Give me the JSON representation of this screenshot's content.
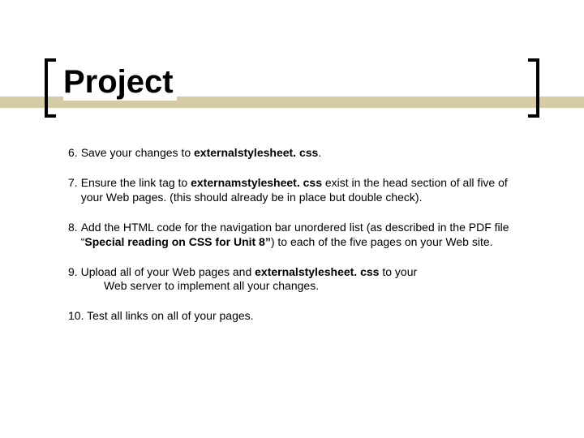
{
  "title": "Project",
  "items": {
    "i6": {
      "num": "6.",
      "t1": "Save your changes to ",
      "b1": "externalstylesheet. css",
      "t2": "."
    },
    "i7": {
      "num": "7.",
      "t1": "Ensure the link tag to ",
      "b1": "externamstylesheet. css",
      "t2": " exist in the head section of all five of your Web pages. (this should already be in place but double check)."
    },
    "i8": {
      "num": "8.",
      "t1": "Add the HTML code for the navigation bar unordered list (as described in the PDF file “",
      "b1": "Special reading on CSS for Unit 8”",
      "t2": ") to each of the five pages on your Web site."
    },
    "i9": {
      "num": "9.",
      "t1": " Upload all of your Web pages and ",
      "b1": "externalstylesheet. css",
      "t2": " to your Web server to implement all your changes."
    },
    "i10": {
      "num": "10.",
      "t1": " Test all links on all of your pages."
    }
  }
}
